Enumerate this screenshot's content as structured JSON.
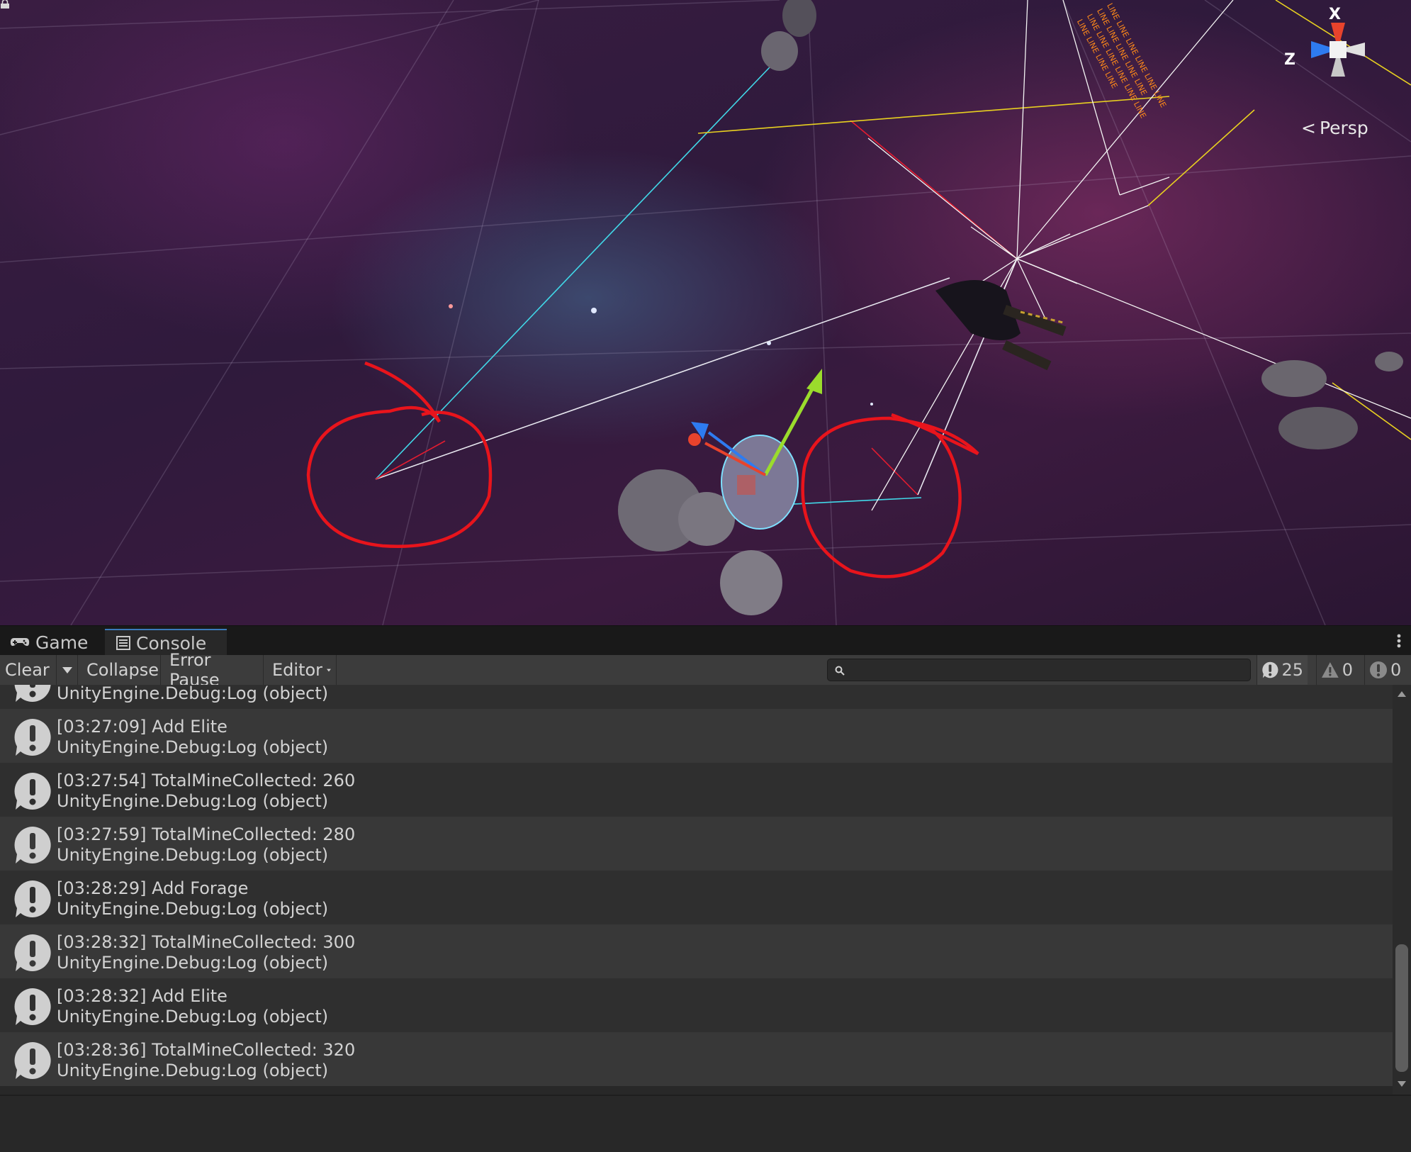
{
  "scene": {
    "gizmo": {
      "x_label": "X",
      "z_label": "Z",
      "projection": "Persp"
    },
    "icons": [
      "lock-icon",
      "scene-gizmo-icon"
    ]
  },
  "tabs": [
    {
      "label": "Game",
      "icon": "gamepad-icon",
      "active": false
    },
    {
      "label": "Console",
      "icon": "console-icon",
      "active": true
    }
  ],
  "toolbar": {
    "clear": "Clear",
    "collapse": "Collapse",
    "error_pause": "Error Pause",
    "editor": "Editor",
    "search_placeholder": "",
    "log_count": "25",
    "warn_count": "0",
    "error_count": "0"
  },
  "log_entries": [
    {
      "line1": "",
      "line2": "UnityEngine.Debug:Log (object)"
    },
    {
      "line1": "[03:27:09] Add Elite",
      "line2": "UnityEngine.Debug:Log (object)"
    },
    {
      "line1": "[03:27:54] TotalMineCollected: 260",
      "line2": "UnityEngine.Debug:Log (object)"
    },
    {
      "line1": "[03:27:59] TotalMineCollected: 280",
      "line2": "UnityEngine.Debug:Log (object)"
    },
    {
      "line1": "[03:28:29] Add Forage",
      "line2": "UnityEngine.Debug:Log (object)"
    },
    {
      "line1": "[03:28:32] TotalMineCollected: 300",
      "line2": "UnityEngine.Debug:Log (object)"
    },
    {
      "line1": "[03:28:32] Add Elite",
      "line2": "UnityEngine.Debug:Log (object)"
    },
    {
      "line1": "[03:28:36] TotalMineCollected: 320",
      "line2": "UnityEngine.Debug:Log (object)"
    }
  ],
  "colors": {
    "accent_tab": "#3a79bb",
    "annotation": "#e8141c",
    "gizmo_x": "#e8432c",
    "gizmo_y": "#9bdc2c",
    "gizmo_z": "#2e7bf0"
  }
}
